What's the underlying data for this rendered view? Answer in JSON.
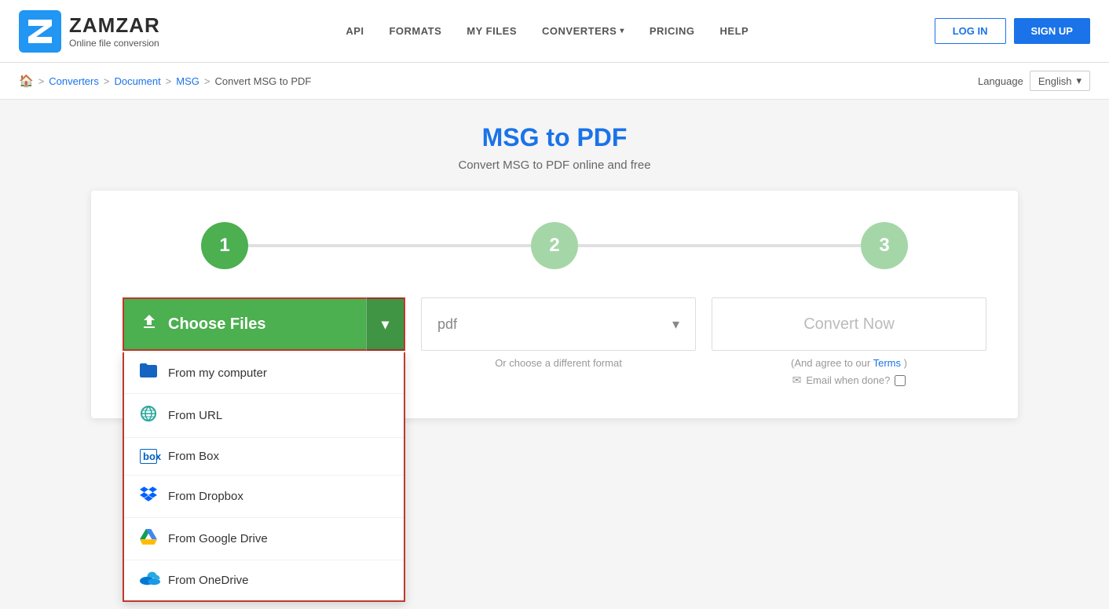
{
  "header": {
    "logo_title": "ZAMZAR",
    "logo_subtitle": "Online file conversion",
    "nav": {
      "api": "API",
      "formats": "FORMATS",
      "my_files": "MY FILES",
      "converters": "CONVERTERS",
      "pricing": "PRICING",
      "help": "HELP"
    },
    "login_label": "LOG IN",
    "signup_label": "SIGN UP"
  },
  "breadcrumb": {
    "home_label": "🏠",
    "converters_label": "Converters",
    "document_label": "Document",
    "msg_label": "MSG",
    "current": "Convert MSG to PDF"
  },
  "language": {
    "label": "Language",
    "current": "English"
  },
  "page": {
    "title": "MSG to PDF",
    "subtitle": "Convert MSG to PDF online and free"
  },
  "steps": {
    "step1": "1",
    "step2": "2",
    "step3": "3"
  },
  "choose_files": {
    "label": "Choose Files",
    "arrow": "▾"
  },
  "dropdown_items": [
    {
      "id": "computer",
      "label": "From my computer",
      "icon_type": "folder"
    },
    {
      "id": "url",
      "label": "From URL",
      "icon_type": "url"
    },
    {
      "id": "box",
      "label": "From Box",
      "icon_type": "box"
    },
    {
      "id": "dropbox",
      "label": "From Dropbox",
      "icon_type": "dropbox"
    },
    {
      "id": "gdrive",
      "label": "From Google Drive",
      "icon_type": "gdrive"
    },
    {
      "id": "onedrive",
      "label": "From OneDrive",
      "icon_type": "onedrive"
    }
  ],
  "format": {
    "current": "pdf",
    "hint": "Or choose a different format"
  },
  "convert": {
    "label": "Convert Now",
    "terms_prefix": "(And agree to our",
    "terms_link": "Terms",
    "terms_suffix": ")",
    "email_label": "Email when done?",
    "arrow": "▾"
  }
}
